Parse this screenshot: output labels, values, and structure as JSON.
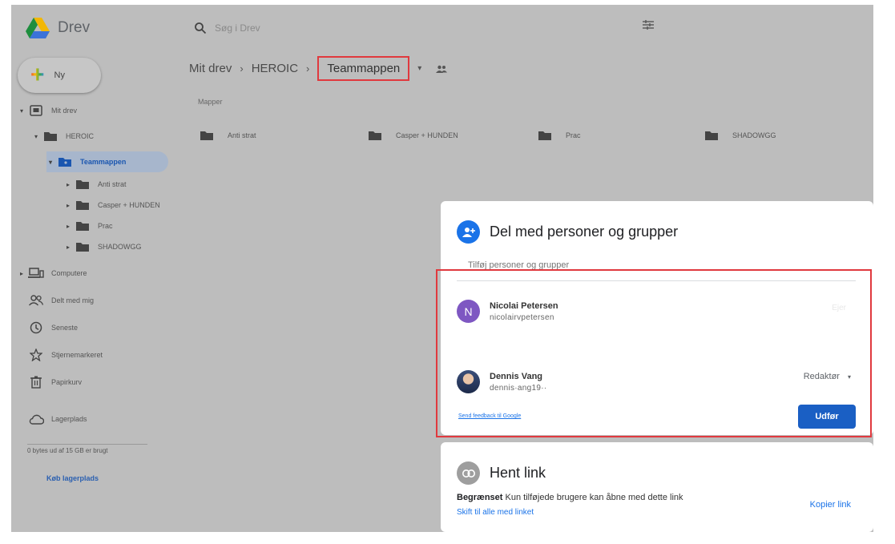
{
  "app": {
    "title": "Drev"
  },
  "search": {
    "placeholder": "Søg i Drev"
  },
  "new_button": {
    "label": "Ny"
  },
  "sidebar": {
    "tree": [
      {
        "label": "Mit drev",
        "icon": "my-drive-icon"
      },
      {
        "label": "HEROIC",
        "icon": "folder-icon"
      },
      {
        "label": "Teammappen",
        "icon": "shared-folder-icon",
        "selected": true
      },
      {
        "label": "Anti strat",
        "icon": "folder-icon"
      },
      {
        "label": "Casper + HUNDEN",
        "icon": "folder-icon"
      },
      {
        "label": "Prac",
        "icon": "folder-icon"
      },
      {
        "label": "SHADOWGG",
        "icon": "folder-icon"
      }
    ],
    "items": [
      {
        "label": "Computere",
        "icon": "computer-icon"
      },
      {
        "label": "Delt med mig",
        "icon": "people-icon"
      },
      {
        "label": "Seneste",
        "icon": "clock-icon"
      },
      {
        "label": "Stjernemarkeret",
        "icon": "star-icon"
      },
      {
        "label": "Papirkurv",
        "icon": "trash-icon"
      },
      {
        "label": "Lagerplads",
        "icon": "cloud-icon"
      }
    ],
    "storage_text": "0 bytes ud af 15 GB er brugt",
    "buy_storage": "Køb lagerplads"
  },
  "breadcrumb": {
    "items": [
      "Mit drev",
      "HEROIC"
    ],
    "current": "Teammappen",
    "tail": "▾"
  },
  "main": {
    "section_label": "Mapper",
    "folders": [
      "Anti strat",
      "Casper + HUNDEN",
      "Prac",
      "SHADOWGG"
    ]
  },
  "share_dialog": {
    "title": "Del med personer og grupper",
    "add_placeholder": "Tilføj personer og grupper",
    "people": [
      {
        "initial": "N",
        "name": "Nicolai Petersen",
        "email": "nicolairvpetersen",
        "role": "Ejer"
      },
      {
        "initial": "",
        "name": "Dennis Vang",
        "email": "dennis·ang19··",
        "role": "Redaktør"
      }
    ],
    "feedback": "Send feedback til Google",
    "done": "Udfør"
  },
  "link_dialog": {
    "title": "Hent link",
    "restriction": "Begrænset",
    "description": "Kun tilføjede brugere kan åbne med dette link",
    "change": "Skift til alle med linket",
    "copy": "Kopier link"
  },
  "colors": {
    "accent": "#1a73e8",
    "highlight_box": "#e0393e",
    "selected_row": "#a7b6cc"
  }
}
